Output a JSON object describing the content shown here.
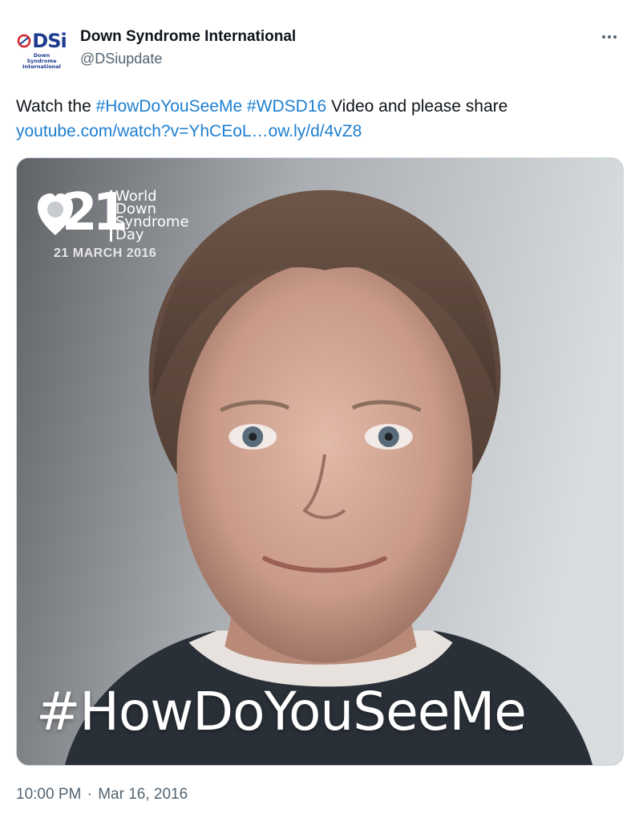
{
  "author": {
    "display_name": "Down Syndrome International",
    "handle": "@DSiupdate",
    "avatar_logo": "DSi",
    "avatar_sub": "Down Syndrome International"
  },
  "more_icon": "more-horizontal-icon",
  "tweet": {
    "text_before": "Watch the ",
    "hashtag1": "#HowDoYouSeeMe",
    "space1": " ",
    "hashtag2": "#WDSD16",
    "text_after": " Video and please share",
    "link1": "youtube.com/watch?v=YhCEoL…",
    "link2": "ow.ly/d/4vZ8"
  },
  "media": {
    "logo_number": "21",
    "logo_lines": [
      "World",
      "Down",
      "Syndrome",
      "Day"
    ],
    "logo_date": "21 MARCH 2016",
    "overlay_hashtag": "#HowDoYouSeeMe"
  },
  "timestamp": {
    "time": "10:00 PM",
    "separator": "·",
    "date": "Mar 16, 2016"
  },
  "colors": {
    "link": "#1d7fd1",
    "secondary_text": "#536471",
    "brand_blue": "#1d3c8f",
    "brand_red": "#d6232a"
  }
}
